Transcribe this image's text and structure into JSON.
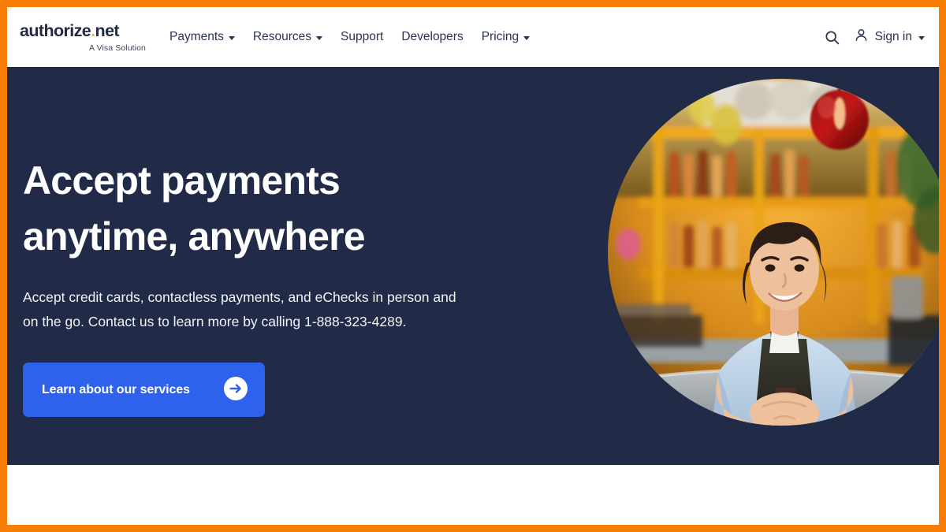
{
  "brand": {
    "logo_text": "authorize",
    "logo_dot": ".",
    "logo_suffix": "net",
    "tagline": "A Visa Solution",
    "logo_color": "#1F2A44",
    "dot_color": "#F5B715"
  },
  "header": {
    "nav_items": [
      {
        "label": "Payments",
        "has_dropdown": true
      },
      {
        "label": "Resources",
        "has_dropdown": true
      },
      {
        "label": "Support",
        "has_dropdown": false
      },
      {
        "label": "Developers",
        "has_dropdown": false
      },
      {
        "label": "Pricing",
        "has_dropdown": true
      }
    ],
    "search_icon": "search-icon",
    "account_icon": "user-icon",
    "signin_label": "Sign in",
    "signin_has_dropdown": true
  },
  "hero": {
    "title": "Accept payments anytime, anywhere",
    "subtitle": "Accept credit cards, contactless payments, and eChecks in person and on the go. Contact us to learn more by calling 1-888-323-4289.",
    "cta_label": "Learn about our services",
    "cta_icon": "arrow-right-circle-icon",
    "cta_color": "#2F62EC",
    "background_color": "#212A46",
    "image_alt": "Smiling small business owner leaning on a bar counter"
  },
  "frame": {
    "border_color": "#F97E06"
  }
}
